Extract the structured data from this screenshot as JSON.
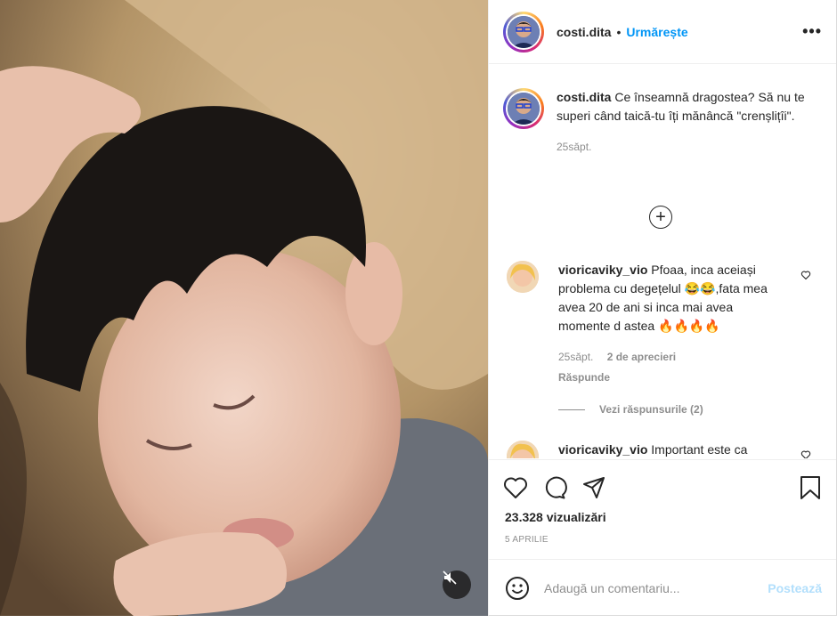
{
  "post": {
    "username": "costi.dita",
    "separator": "•",
    "follow_label": "Urmărește",
    "more_label": "•••",
    "caption_text": "Ce înseamnă dragostea? Să nu te superi când taică-tu îți mănâncă \"crenșlițîi\".",
    "caption_time": "25săpt.",
    "load_more_symbol": "+"
  },
  "comments": [
    {
      "username": "vioricaviky_vio",
      "text": "Pfoaa, inca aceiași problema cu degețelul 😂😂,fata mea avea 20 de ani si inca mai avea momente d astea 🔥🔥🔥🔥",
      "time": "25săpt.",
      "likes": "2 de aprecieri",
      "reply_label": "Răspunde",
      "view_replies": "Vezi răspunsurile (2)"
    },
    {
      "username": "vioricaviky_vio",
      "text": "Important este ca"
    }
  ],
  "stats": {
    "views": "23.328 vizualizări",
    "date": "5 APRILIE"
  },
  "composer": {
    "placeholder": "Adaugă un comentariu...",
    "post_label": "Postează"
  },
  "icons": {
    "like": "heart-icon",
    "comment": "comment-icon",
    "share": "share-icon",
    "save": "bookmark-icon",
    "emoji": "emoji-icon",
    "mute": "muted-speaker-icon"
  },
  "colors": {
    "accent": "#0095f6",
    "muted_text": "#8e8e8e",
    "post_disabled": "#b2dffc"
  }
}
